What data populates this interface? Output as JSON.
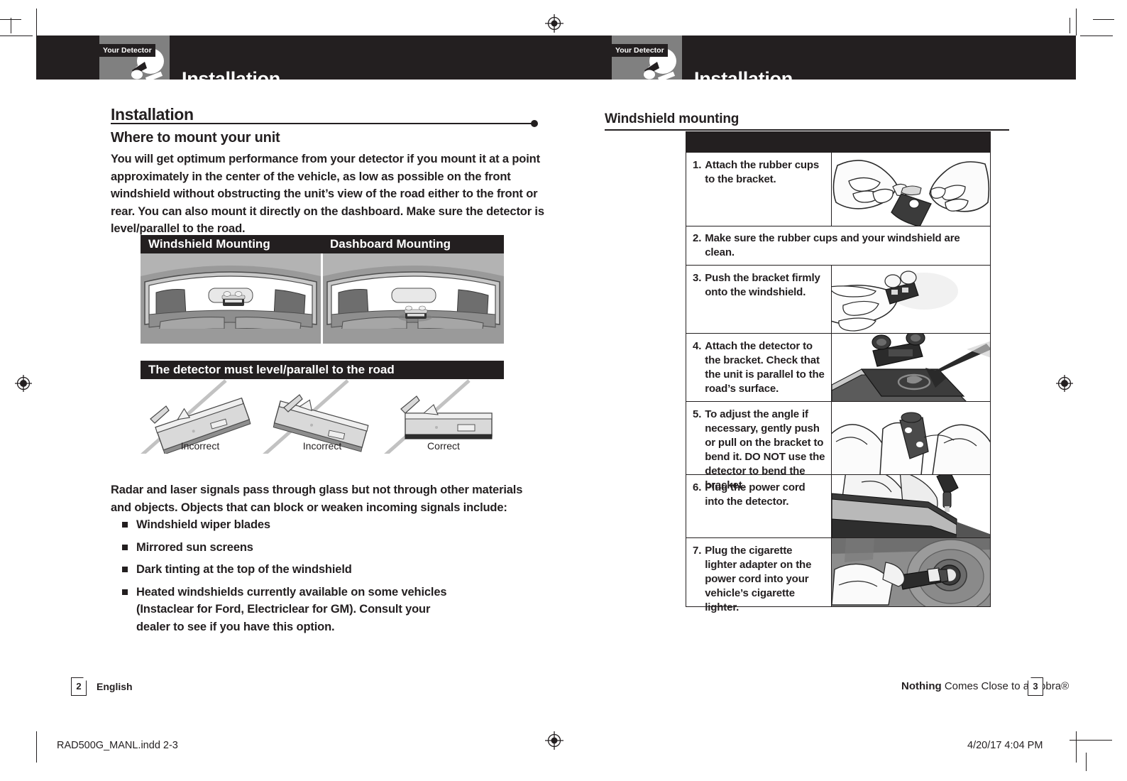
{
  "document": {
    "slug_left": "RAD500G_MANL.indd   2-3",
    "slug_right": "4/20/17   4:04 PM"
  },
  "left_page": {
    "header": {
      "title": "Installation",
      "icon_tag": "Your Detector",
      "icon_name": "radar-detector-icon"
    },
    "heading": "Installation",
    "subheading": "Where to mount your unit",
    "intro_paragraph": "You will get optimum performance from your detector if you mount it at a point approximately in the center of the vehicle, as low as possible on the front windshield without obstructing the unit’s view of the road either to the front or rear. You can also mount it directly on the dashboard. Make sure the detector is level/parallel to the road.",
    "mounting_figure": {
      "captions": [
        "Windshield Mounting",
        "Dashboard Mounting"
      ]
    },
    "level_figure": {
      "caption": "The detector must level/parallel to the road",
      "labels": [
        "Incorrect",
        "Incorrect",
        "Correct"
      ]
    },
    "signals_paragraph": "Radar and laser signals pass through glass but not through other materials and objects. Objects that can block or weaken incoming signals include:",
    "bullets": [
      "Windshield wiper blades",
      "Mirrored sun screens",
      "Dark tinting at the top of the windshield",
      "Heated windshields currently available on some vehicles (Instaclear for Ford, Electriclear for GM). Consult your dealer to see if you have this option."
    ],
    "footer": {
      "page_number": "2",
      "language": "English"
    }
  },
  "right_page": {
    "header": {
      "title": "Installation",
      "icon_tag": "Your Detector",
      "icon_name": "radar-detector-icon"
    },
    "heading": "Windshield mounting",
    "steps": [
      {
        "number": "1.",
        "text": "Attach the rubber cups to the bracket.",
        "image": "hands-attaching-rubber-cups-illustration",
        "full_width": false
      },
      {
        "number": "2.",
        "text": "Make sure the rubber cups and your windshield are clean.",
        "image": null,
        "full_width": true
      },
      {
        "number": "3.",
        "text": "Push the bracket firmly onto the windshield.",
        "image": "hand-pushing-bracket-illustration",
        "full_width": false
      },
      {
        "number": "4.",
        "text": "Attach the detector to the bracket. Check that the unit is parallel to the road’s surface.",
        "image": "detector-sliding-onto-bracket-illustration",
        "full_width": false
      },
      {
        "number": "5.",
        "text": "To adjust the angle if necessary, gently push or pull on the bracket to bend it. DO NOT use the detector to bend the bracket.",
        "image": "hands-bending-bracket-illustration",
        "full_width": false
      },
      {
        "number": "6.",
        "text": "Plug the power cord into the detector.",
        "image": "power-cord-into-detector-illustration",
        "full_width": false
      },
      {
        "number": "7.",
        "text": "Plug the cigarette lighter adapter on the power cord into your vehicle’s cigarette lighter.",
        "image": "cigarette-lighter-adapter-illustration",
        "full_width": false
      }
    ],
    "footer": {
      "page_number": "3",
      "tagline_bold": "Nothing",
      "tagline_rest": "Comes Close to a Cobra®"
    }
  },
  "colors": {
    "ink": "#231f20",
    "panel_gray": "#808080",
    "paper": "#ffffff"
  }
}
